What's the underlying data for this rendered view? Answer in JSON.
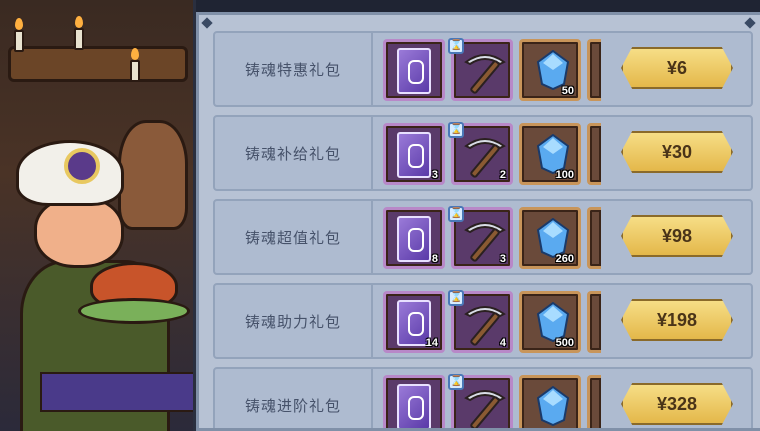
{
  "packs": [
    {
      "name": "铸魂特惠礼包",
      "book_qty": "",
      "pick_qty": "",
      "gem_qty": "50",
      "price": "¥6"
    },
    {
      "name": "铸魂补给礼包",
      "book_qty": "3",
      "pick_qty": "2",
      "gem_qty": "100",
      "price": "¥30"
    },
    {
      "name": "铸魂超值礼包",
      "book_qty": "8",
      "pick_qty": "3",
      "gem_qty": "260",
      "price": "¥98"
    },
    {
      "name": "铸魂助力礼包",
      "book_qty": "14",
      "pick_qty": "4",
      "gem_qty": "500",
      "price": "¥198"
    },
    {
      "name": "铸魂进阶礼包",
      "book_qty": "",
      "pick_qty": "",
      "gem_qty": "",
      "price": "¥328"
    }
  ],
  "icons": {
    "book": "purple-spellbook-icon",
    "pickaxe": "pickaxe-icon",
    "gem": "blue-crystal-icon",
    "badge": "hourglass-badge-icon"
  },
  "colors": {
    "panel": "#b7c2d4",
    "row": "#aebbd0",
    "price_gold": "#e4b84a",
    "item_border": "#c8955a"
  }
}
